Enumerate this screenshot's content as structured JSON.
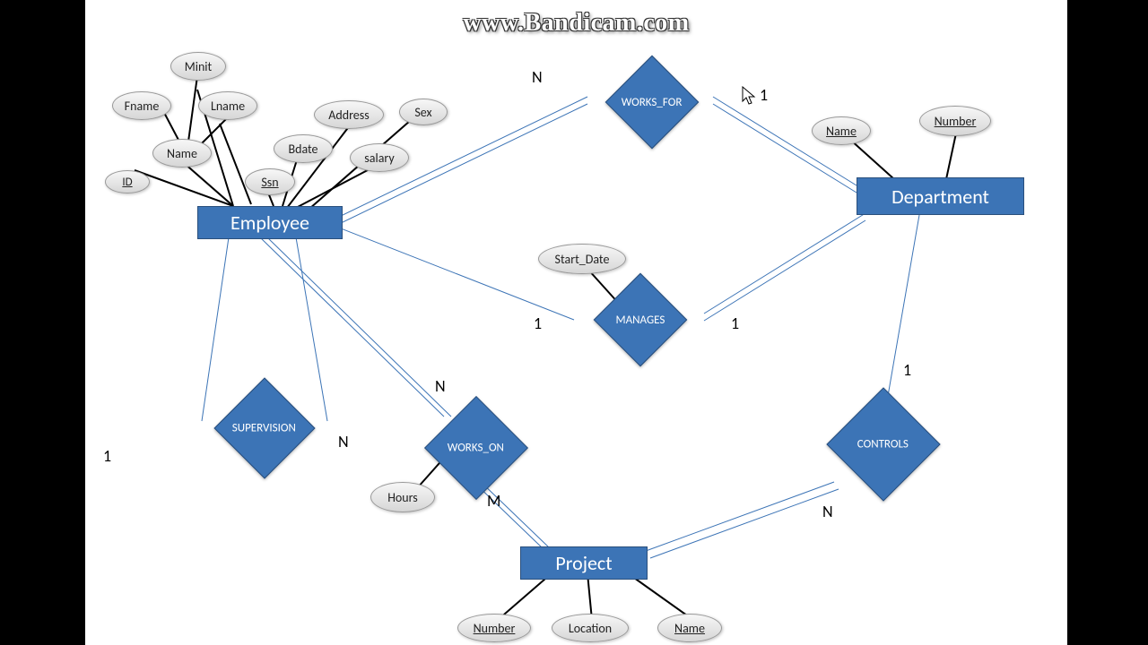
{
  "watermark": "www.Bandicam.com",
  "entities": {
    "employee": "Employee",
    "department": "Department",
    "project": "Project"
  },
  "relationships": {
    "works_for": "WORKS_FOR",
    "manages": "MANAGES",
    "supervision": "SUPERVISION",
    "works_on": "WORKS_ON",
    "controls": "CONTROLS"
  },
  "attributes": {
    "minit": "Minit",
    "fname": "Fname",
    "lname": "Lname",
    "name_emp": "Name",
    "id": "ID",
    "ssn": "Ssn",
    "bdate": "Bdate",
    "address": "Address",
    "salary": "salary",
    "sex": "Sex",
    "dept_name": "Name",
    "dept_number": "Number",
    "start_date": "Start_Date",
    "hours": "Hours",
    "proj_number": "Number",
    "location": "Location",
    "proj_name": "Name"
  },
  "cardinalities": {
    "wf_n": "N",
    "wf_1": "1",
    "mg_1a": "1",
    "mg_1b": "1",
    "sup_1": "1",
    "sup_n": "N",
    "wo_n": "N",
    "wo_m": "M",
    "ctrl_1": "1",
    "ctrl_n": "N"
  }
}
